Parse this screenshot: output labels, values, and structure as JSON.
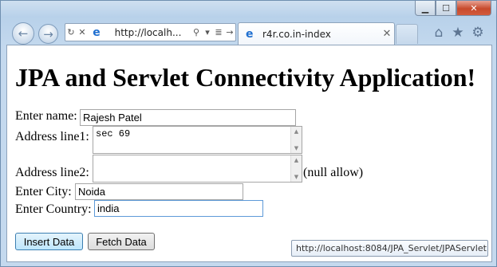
{
  "window": {
    "controls": {
      "minimize_icon": "minimize-icon",
      "maximize_icon": "maximize-icon",
      "close_icon": "close-icon"
    }
  },
  "browser": {
    "address_url": "http://localh...",
    "tab_title": "r4r.co.in-index",
    "icons": [
      "back-arrow-icon",
      "forward-arrow-icon",
      "refresh-icon",
      "stop-icon",
      "search-icon",
      "compatibility-icon",
      "go-icon",
      "home-icon",
      "favorites-star-icon",
      "gear-icon"
    ]
  },
  "page": {
    "title": "JPA and Servlet Connectivity Application!",
    "form": {
      "name_label": "Enter name:",
      "name_value": "Rajesh Patel",
      "address1_label": "Address line1:",
      "address1_value": "sec 69",
      "address2_label": "Address line2:",
      "address2_value": "",
      "address2_note": "(null allow)",
      "city_label": "Enter City:",
      "city_value": "Noida",
      "country_label": "Enter Country:",
      "country_value": "india"
    },
    "buttons": {
      "insert": "Insert Data",
      "fetch": "Fetch Data"
    }
  },
  "status": {
    "link_url": "http://localhost:8084/JPA_Servlet/JPAServlet"
  }
}
